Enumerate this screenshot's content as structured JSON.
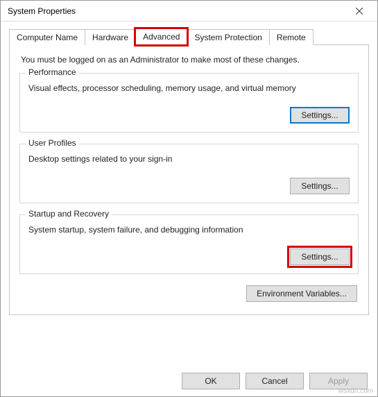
{
  "window": {
    "title": "System Properties"
  },
  "tabs": {
    "computer_name": "Computer Name",
    "hardware": "Hardware",
    "advanced": "Advanced",
    "system_protection": "System Protection",
    "remote": "Remote"
  },
  "panel": {
    "intro": "You must be logged on as an Administrator to make most of these changes.",
    "performance": {
      "title": "Performance",
      "desc": "Visual effects, processor scheduling, memory usage, and virtual memory",
      "button": "Settings..."
    },
    "user_profiles": {
      "title": "User Profiles",
      "desc": "Desktop settings related to your sign-in",
      "button": "Settings..."
    },
    "startup": {
      "title": "Startup and Recovery",
      "desc": "System startup, system failure, and debugging information",
      "button": "Settings..."
    },
    "env_button": "Environment Variables..."
  },
  "footer": {
    "ok": "OK",
    "cancel": "Cancel",
    "apply": "Apply"
  },
  "watermark": "wsxdn.com"
}
